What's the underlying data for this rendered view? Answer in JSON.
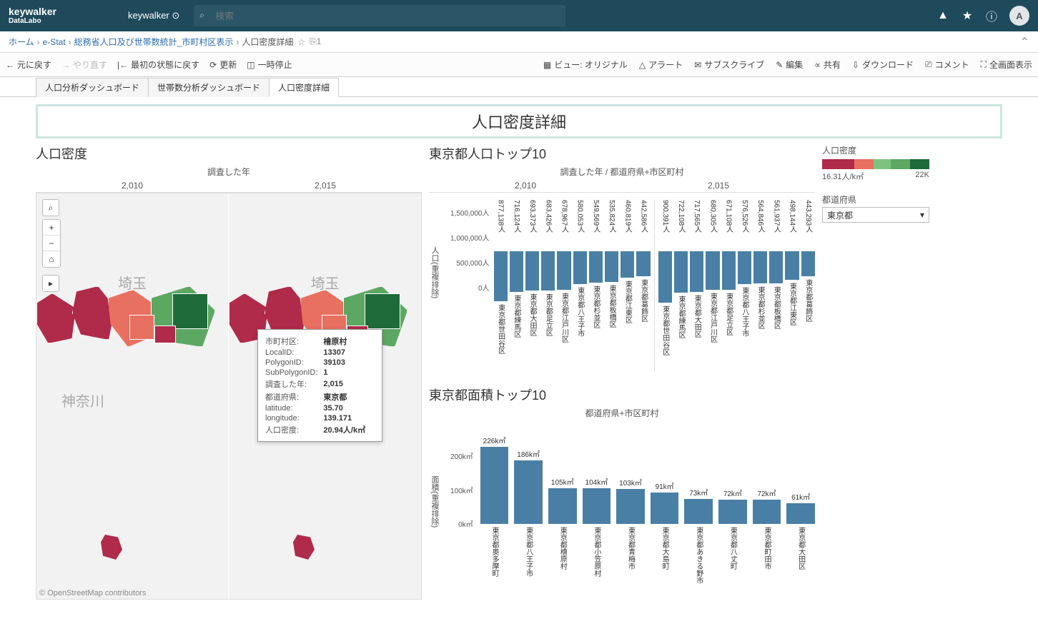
{
  "header": {
    "logo_main": "keywalker",
    "logo_sub": "DataLabo",
    "org": "keywalker",
    "search_placeholder": "検索",
    "avatar_letter": "A"
  },
  "breadcrumb": {
    "home": "ホーム",
    "l1": "e-Stat",
    "l2": "総務省人口及び世帯数統計_市町村区表示",
    "current": "人口密度詳細",
    "count": "1"
  },
  "toolbar": {
    "undo": "元に戻す",
    "redo": "やり直す",
    "revert": "最初の状態に戻す",
    "refresh": "更新",
    "pause": "一時停止",
    "view": "ビュー: オリジナル",
    "alert": "アラート",
    "subscribe": "サブスクライブ",
    "edit": "編集",
    "share": "共有",
    "download": "ダウンロード",
    "comment": "コメント",
    "fullscreen": "全画面表示"
  },
  "tabs": {
    "t1": "人口分析ダッシュボード",
    "t2": "世帯数分析ダッシュボード",
    "t3": "人口密度詳細"
  },
  "page_title": "人口密度詳細",
  "map": {
    "section_title": "人口密度",
    "survey_year_label": "調査した年",
    "year1": "2,010",
    "year2": "2,015",
    "saitama": "埼玉",
    "kanagawa": "神奈川",
    "attribution": "© OpenStreetMap contributors"
  },
  "tooltip": {
    "k1": "市町村区:",
    "v1": "檜原村",
    "k2": "LocalID:",
    "v2": "13307",
    "k3": "PolygonID:",
    "v3": "39103",
    "k4": "SubPolygonID:",
    "v4": "1",
    "k5": "調査した年:",
    "v5": "2,015",
    "k6": "都道府県:",
    "v6": "東京都",
    "k7": "latitude:",
    "v7": "35.70",
    "k8": "longitude:",
    "v8": "139.171",
    "k9": "人口密度:",
    "v9": "20.94人/k㎡"
  },
  "chart1": {
    "section_title": "東京都人口トップ10",
    "header": "調査した年 / 都道府県+市区町村",
    "year1": "2,010",
    "year2": "2,015",
    "y_label": "人口(重複排除)",
    "tick0": "0人",
    "tick1": "500,000人",
    "tick2": "1,000,000人",
    "tick3": "1,500,000人"
  },
  "chart2": {
    "section_title": "東京都面積トップ10",
    "header": "都道府県+市区町村",
    "y_label": "面積(重複排除)",
    "tickA": "0k㎡",
    "tickB": "100k㎡",
    "tickC": "200k㎡"
  },
  "sidebar": {
    "legend_title": "人口密度",
    "legend_min": "16.31人/k㎡",
    "legend_max": "22K",
    "filter_label": "都道府県",
    "filter_value": "東京都"
  },
  "chart_data": [
    {
      "type": "bar",
      "title": "東京都人口トップ10",
      "ylabel": "人口(重複排除)",
      "ylim": [
        0,
        1500000
      ],
      "series_group": "調査した年",
      "groups": [
        {
          "group": "2010",
          "categories": [
            "東京都世田谷区",
            "東京都練馬区",
            "東京都大田区",
            "東京都足立区",
            "東京都江戸川区",
            "東京都八王子市",
            "東京都杉並区",
            "東京都板橋区",
            "東京都江東区",
            "東京都葛飾区"
          ],
          "values": [
            877138,
            716124,
            693373,
            683426,
            678967,
            580053,
            549569,
            535824,
            460819,
            442586
          ],
          "value_labels": [
            "877,138人",
            "716,124人",
            "693,373人",
            "683,426人",
            "678,967人",
            "580,053人",
            "549,569人",
            "535,824人",
            "460,819人",
            "442,586人"
          ]
        },
        {
          "group": "2015",
          "categories": [
            "東京都世田谷区",
            "東京都練馬区",
            "東京都大田区",
            "東京都江戸川区",
            "東京都足立区",
            "東京都八王子市",
            "東京都杉並区",
            "東京都板橋区",
            "東京都江東区",
            "東京都葛飾区"
          ],
          "values": [
            900391,
            722108,
            717565,
            680305,
            671108,
            576526,
            564846,
            561937,
            498144,
            443293
          ],
          "value_labels": [
            "900,391人",
            "722,108人",
            "717,565人",
            "680,305人",
            "671,108人",
            "576,526人",
            "564,846人",
            "561,937人",
            "498,144人",
            "443,293人"
          ]
        }
      ]
    },
    {
      "type": "bar",
      "title": "東京都面積トップ10",
      "ylabel": "面積(重複排除)",
      "ylim": [
        0,
        230
      ],
      "categories": [
        "東京都奥多摩町",
        "東京都八王子市",
        "東京都檜原村",
        "東京都小笠原村",
        "東京都青梅市",
        "東京都大島町",
        "東京都あきる野市",
        "東京都八丈町",
        "東京都町田市",
        "東京都大田区"
      ],
      "values": [
        226,
        186,
        105,
        104,
        103,
        91,
        73,
        72,
        72,
        61
      ],
      "value_labels": [
        "226k㎡",
        "186k㎡",
        "105k㎡",
        "104k㎡",
        "103k㎡",
        "91k㎡",
        "73k㎡",
        "72k㎡",
        "72k㎡",
        "61k㎡"
      ]
    }
  ]
}
